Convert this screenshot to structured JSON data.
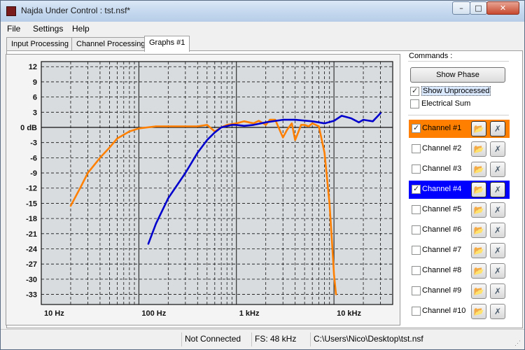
{
  "window": {
    "title": "Najda Under Control : tst.nsf*",
    "min_glyph": "–",
    "max_glyph": "□",
    "close_glyph": "✕"
  },
  "menu": [
    "File",
    "Settings",
    "Help"
  ],
  "tabs": [
    "Input Processing",
    "Channel Processing",
    "Graphs #1"
  ],
  "active_tab": 2,
  "graph": {
    "y_labels": [
      "12",
      "9",
      "6",
      "3",
      "0 dB",
      "-3",
      "-6",
      "-9",
      "-12",
      "-15",
      "-18",
      "-21",
      "-24",
      "-27",
      "-30",
      "-33"
    ],
    "x_labels": [
      "10 Hz",
      "100 Hz",
      "1 kHz",
      "10 kHz"
    ],
    "colors": {
      "orange": "#ff8000",
      "blue": "#0000cd",
      "grid_bg": "#d9dcdf"
    }
  },
  "chart_data": {
    "type": "line",
    "title": "",
    "xlabel": "",
    "ylabel": "",
    "x_scale": "log",
    "xlim": [
      10,
      40000
    ],
    "ylim": [
      -35,
      13
    ],
    "x_tick_labels": [
      "10 Hz",
      "100 Hz",
      "1 kHz",
      "10 kHz"
    ],
    "y_tick_labels": [
      "12",
      "9",
      "6",
      "3",
      "0 dB",
      "-3",
      "-6",
      "-9",
      "-12",
      "-15",
      "-18",
      "-21",
      "-24",
      "-27",
      "-30",
      "-33"
    ],
    "grid": true,
    "series": [
      {
        "color": "#ff8000",
        "x": [
          20,
          25,
          30,
          40,
          50,
          60,
          80,
          100,
          150,
          200,
          300,
          400,
          500,
          600,
          700,
          800,
          1000,
          1200,
          1500,
          1700,
          2000,
          2200,
          2500,
          3000,
          3300,
          3700,
          4000,
          4300,
          4600,
          5000,
          5500,
          6000,
          7000,
          8000,
          9000,
          9500,
          10000,
          10500
        ],
        "y": [
          -15.5,
          -12,
          -9,
          -6,
          -4,
          -2.2,
          -0.8,
          -0.2,
          0.2,
          0.2,
          0.2,
          0.2,
          0.5,
          -0.8,
          0,
          0.5,
          0.8,
          1.2,
          0.8,
          1.3,
          0.5,
          1.5,
          1.5,
          -2,
          -0.5,
          0.8,
          -2.5,
          -1,
          0.5,
          0.5,
          0.2,
          0.8,
          0.2,
          -5,
          -15,
          -22,
          -29,
          -33
        ]
      },
      {
        "color": "#0000cd",
        "x": [
          125,
          150,
          200,
          300,
          400,
          500,
          600,
          700,
          900,
          1000,
          1200,
          1500,
          2000,
          3000,
          4000,
          6000,
          8000,
          10000,
          12000,
          15000,
          18000,
          20000,
          25000,
          28000,
          30000
        ],
        "y": [
          -23,
          -19,
          -14,
          -9,
          -5,
          -2.5,
          -1,
          0,
          0.5,
          0.5,
          0.3,
          0.5,
          1.0,
          1.5,
          1.5,
          1.2,
          0.8,
          1.3,
          2.3,
          1.8,
          1.0,
          1.5,
          1.2,
          2.2,
          2.8
        ]
      }
    ]
  },
  "commands": {
    "label": "Commands :",
    "show_phase": "Show Phase",
    "show_unprocessed": {
      "label": "Show Unprocessed",
      "checked": true
    },
    "electrical_sum": {
      "label": "Electrical Sum",
      "checked": false
    }
  },
  "channels": [
    {
      "label": "Channel #1",
      "checked": true,
      "highlight": "orange"
    },
    {
      "label": "Channel #2",
      "checked": false,
      "highlight": ""
    },
    {
      "label": "Channel #3",
      "checked": false,
      "highlight": ""
    },
    {
      "label": "Channel #4",
      "checked": true,
      "highlight": "blue"
    },
    {
      "label": "Channel #5",
      "checked": false,
      "highlight": ""
    },
    {
      "label": "Channel #6",
      "checked": false,
      "highlight": ""
    },
    {
      "label": "Channel #7",
      "checked": false,
      "highlight": ""
    },
    {
      "label": "Channel #8",
      "checked": false,
      "highlight": ""
    },
    {
      "label": "Channel #9",
      "checked": false,
      "highlight": ""
    },
    {
      "label": "Channel #10",
      "checked": false,
      "highlight": ""
    }
  ],
  "channel_icons": {
    "open_glyph": "📂",
    "clear_glyph": "✗"
  },
  "status": {
    "connection": "Not Connected",
    "fs": "FS: 48 kHz",
    "path": "C:\\Users\\Nico\\Desktop\\tst.nsf"
  }
}
